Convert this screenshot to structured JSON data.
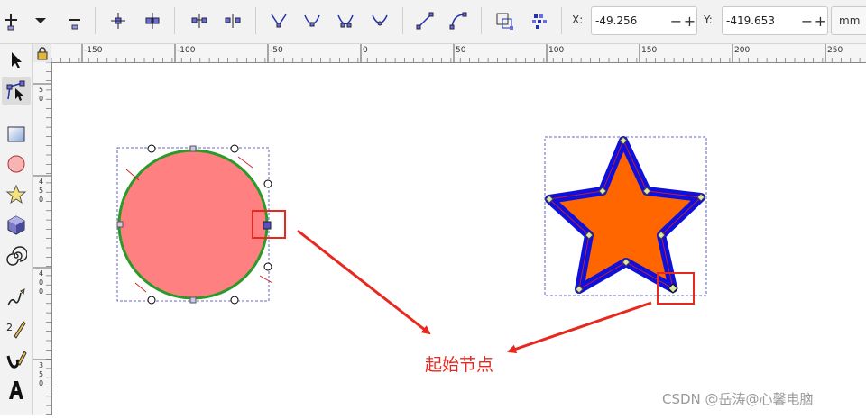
{
  "toolbar": {
    "x_label": "X:",
    "x_value": "-49.256",
    "y_label": "Y:",
    "y_value": "-419.653",
    "minus": "−",
    "plus": "+",
    "unit": "mm"
  },
  "ruler": {
    "h_ticks": [
      "-150",
      "-100",
      "-50",
      "0",
      "50",
      "100",
      "150",
      "200",
      "250"
    ],
    "v_groups": [
      [
        "5",
        "0"
      ],
      [
        "4",
        "5",
        "0"
      ],
      [
        "4",
        "0",
        "0"
      ],
      [
        "3",
        "5",
        "0"
      ]
    ]
  },
  "canvas": {
    "annotation": "起始节点",
    "watermark": "CSDN @岳涛@心馨电脑"
  },
  "colors": {
    "circle_fill": "#ff8080",
    "circle_stroke": "#2a9a2a",
    "star_fill": "#ff6600",
    "star_stroke": "#1010dd",
    "highlight": "#e8281e",
    "arrow": "#e8281e"
  }
}
